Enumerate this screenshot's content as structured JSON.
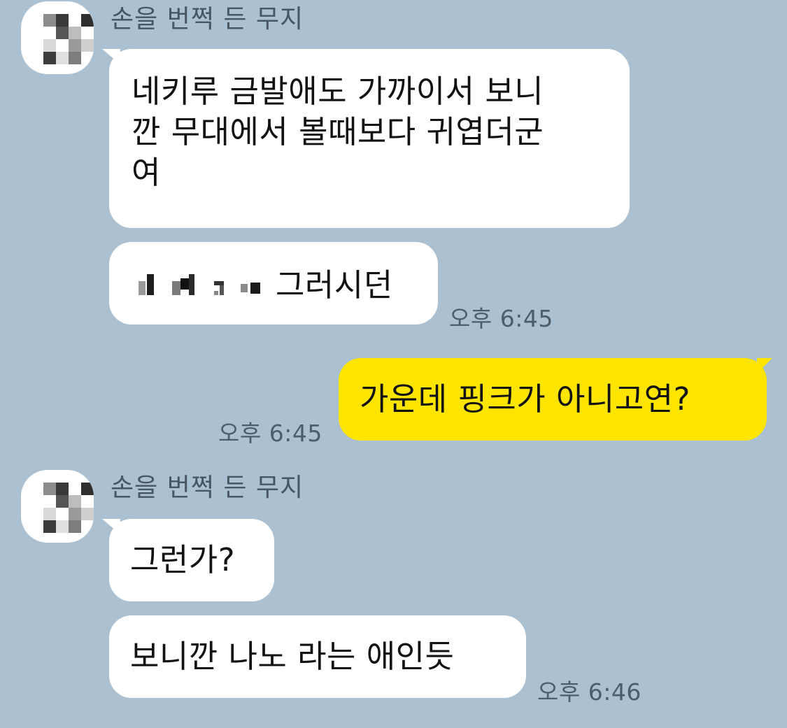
{
  "chat": {
    "messages": [
      {
        "sender": "손을 번쩍 든 무지",
        "bubbles": [
          {
            "lines": [
              "네키루 금발애도 가까이서 보니",
              "깐 무대에서 볼때보다 귀엽더군",
              "여"
            ]
          },
          {
            "redacted": true,
            "text_after_redaction": "그러시던",
            "time": "오후 6:45"
          }
        ]
      },
      {
        "from_me": true,
        "text": "가운데 핑크가 아니고연?",
        "time": "오후 6:45"
      },
      {
        "sender": "손을 번쩍 든 무지",
        "bubbles": [
          {
            "text": "그런가?"
          },
          {
            "text": "보니깐 나노 라는 애인듯",
            "time": "오후 6:46"
          }
        ]
      }
    ]
  },
  "colors": {
    "background": "#abc0d0",
    "incoming_bubble": "#ffffff",
    "outgoing_bubble": "#fee500",
    "sender_name": "#475663",
    "timestamp": "#4e5d6a"
  }
}
